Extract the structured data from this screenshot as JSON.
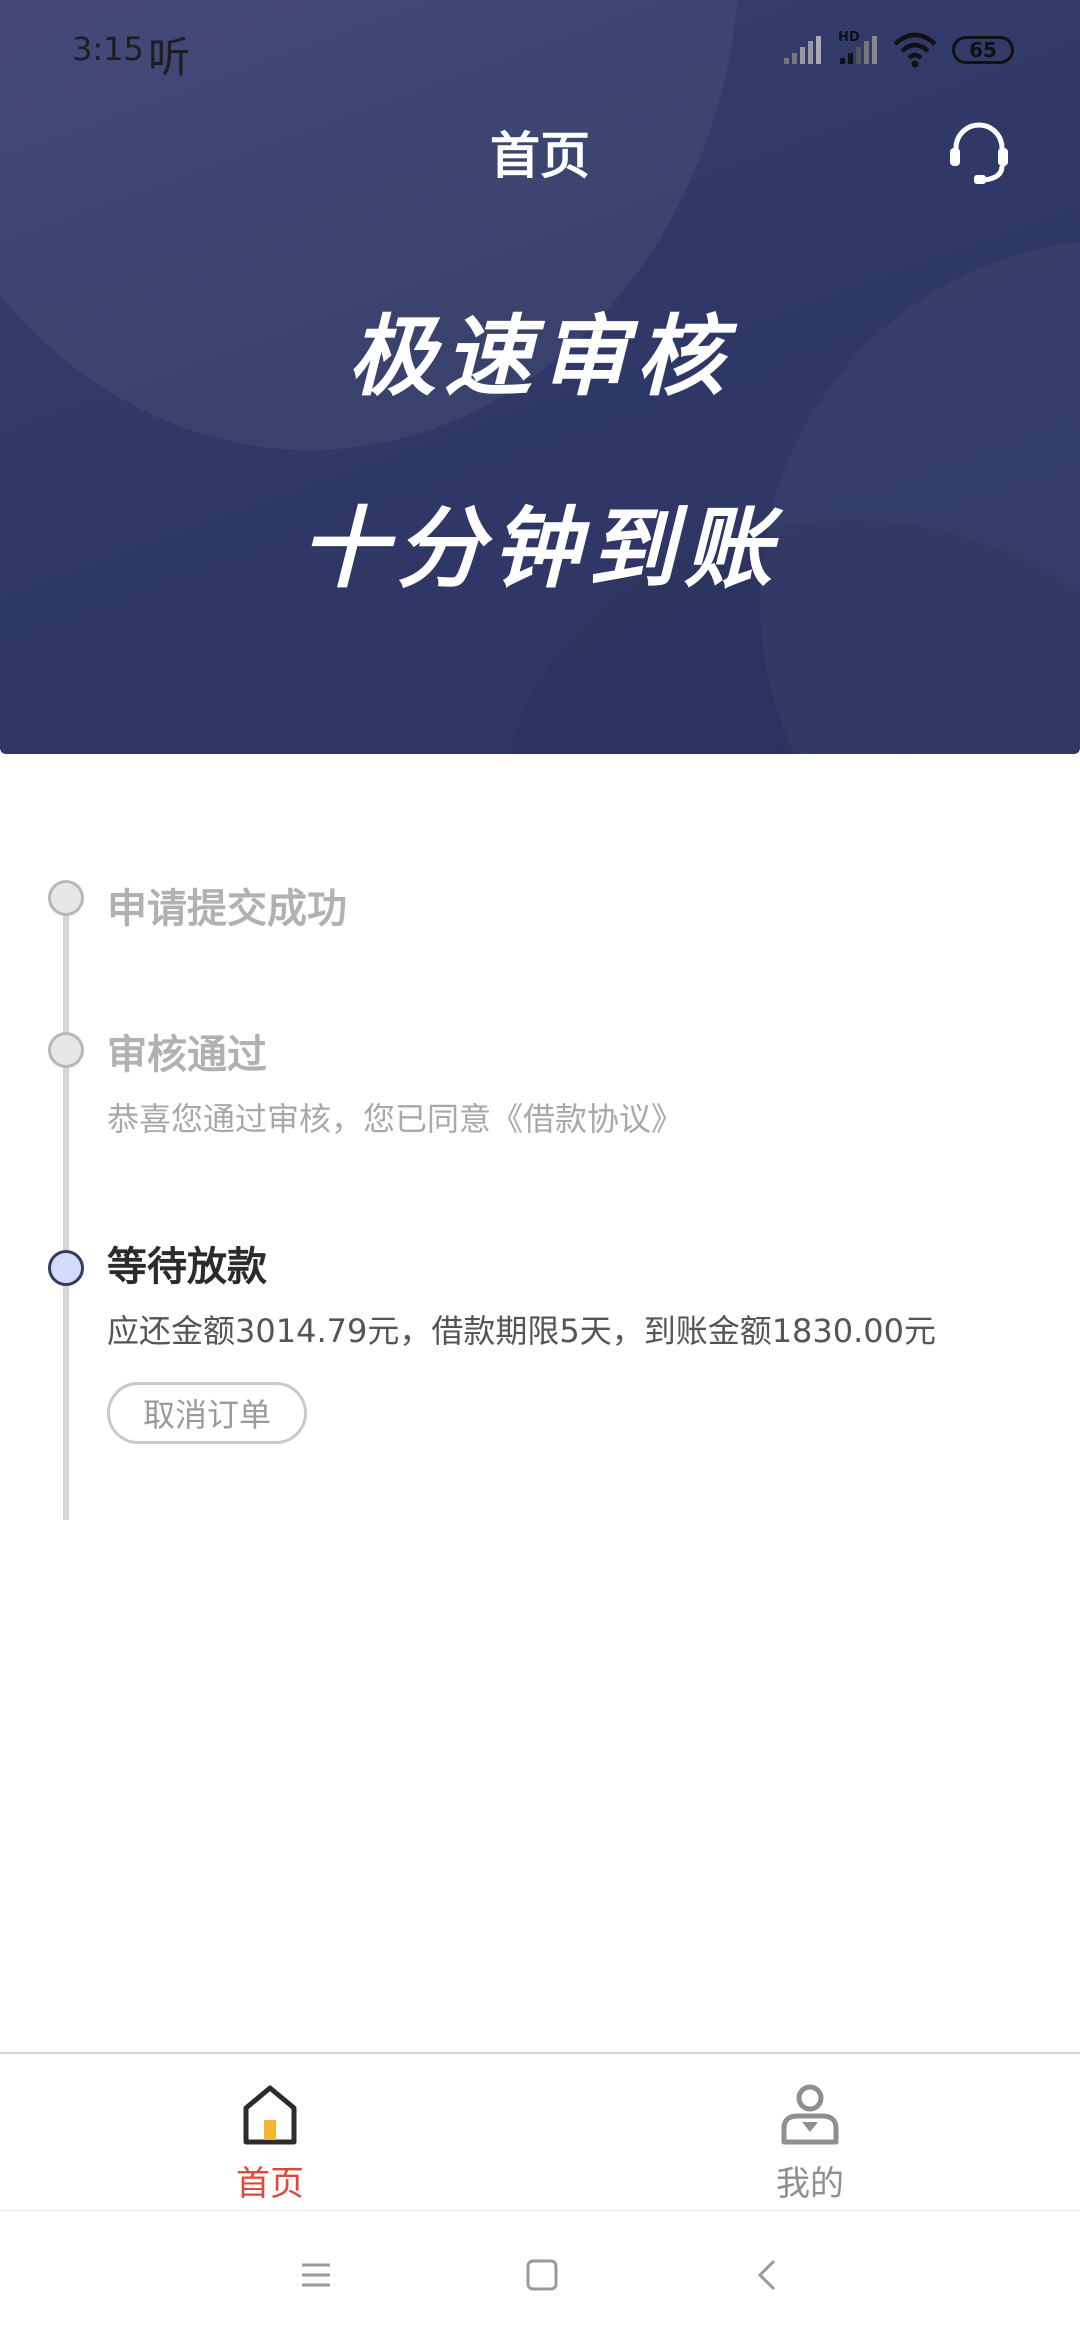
{
  "status_bar": {
    "time": "3:15",
    "app_indicator": "听",
    "network_label": "HD",
    "battery": "65"
  },
  "header": {
    "title": "首页",
    "support_icon": "headset-icon",
    "slogan_line1": "极速审核",
    "slogan_line2": "十分钟到账",
    "colors": {
      "banner": "#2f3866",
      "text": "#ffffff"
    }
  },
  "timeline": {
    "steps": [
      {
        "title": "申请提交成功",
        "description": "",
        "state": "done"
      },
      {
        "title": "审核通过",
        "description": "恭喜您通过审核，您已同意《借款协议》",
        "state": "done"
      },
      {
        "title": "等待放款",
        "description": "应还金额3014.79元，借款期限5天，到账金额1830.00元",
        "state": "active"
      }
    ],
    "cancel_label": "取消订单"
  },
  "tabbar": {
    "items": [
      {
        "label": "首页",
        "icon": "home-icon",
        "selected": true
      },
      {
        "label": "我的",
        "icon": "user-icon",
        "selected": false
      }
    ],
    "colors": {
      "active": "#e0483b",
      "inactive": "#8f8f8f"
    }
  },
  "system_nav": {
    "icons": [
      "menu-icon",
      "home-square-icon",
      "back-icon"
    ]
  }
}
